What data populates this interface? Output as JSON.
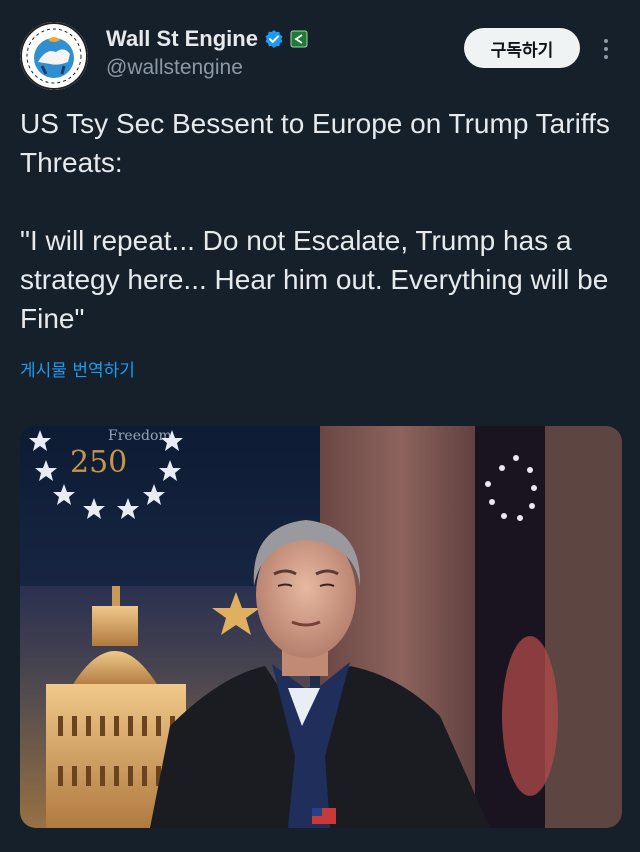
{
  "author": {
    "display_name": "Wall St Engine",
    "handle": "@wallstengine",
    "verified_icon": "verified-badge-icon",
    "affiliation_icon": "affiliate-flag-icon"
  },
  "header": {
    "subscribe_label": "구독하기",
    "more_icon": "more-vertical-icon"
  },
  "tweet": {
    "text": "US Tsy Sec Bessent to Europe on Trump Tariffs Threats:\n\n\"I will repeat... Do not Escalate, Trump has a strategy here... Hear him out. Everything will be Fine\"",
    "translate_label": "게시물 번역하기"
  },
  "media": {
    "banner_top": "Freedom",
    "banner_number": "250",
    "description_icon": "photo"
  },
  "colors": {
    "background": "#15202b",
    "text": "#e7e9ea",
    "secondary": "#8b98a5",
    "link": "#1d9bf0",
    "verified": "#1d9bf0"
  }
}
